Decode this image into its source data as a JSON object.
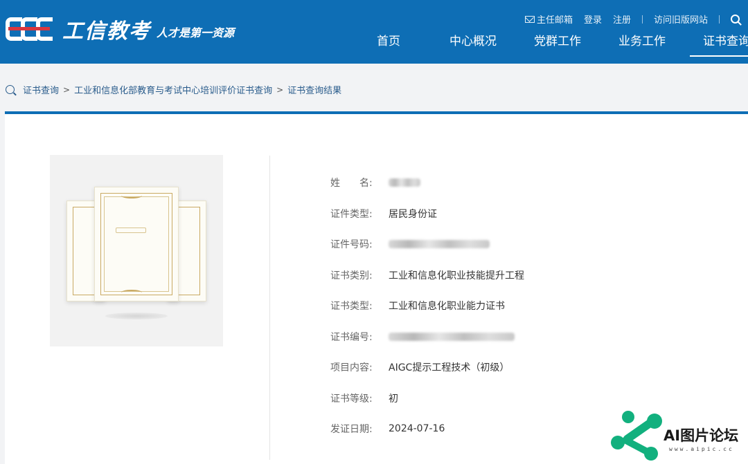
{
  "header": {
    "logo_text": "工信教考",
    "slogan": "人才是第一资源",
    "top_links": {
      "mail": "主任邮箱",
      "login": "登录",
      "register": "注册",
      "old_site": "访问旧版网站"
    },
    "nav": [
      "首页",
      "中心概况",
      "党群工作",
      "业务工作",
      "证书查询"
    ],
    "active_nav": "证书查询"
  },
  "breadcrumb": {
    "items": [
      "证书查询",
      "工业和信息化部教育与考试中心培训评价证书查询",
      "证书查询结果"
    ],
    "separator": ">"
  },
  "certificate": {
    "fields": [
      {
        "label": "姓　　名:",
        "value": "",
        "redacted": true
      },
      {
        "label": "证件类型:",
        "value": "居民身份证",
        "redacted": false
      },
      {
        "label": "证件号码:",
        "value": "",
        "redacted": true
      },
      {
        "label": "证书类别:",
        "value": "工业和信息化职业技能提升工程",
        "redacted": false
      },
      {
        "label": "证书类型:",
        "value": "工业和信息化职业能力证书",
        "redacted": false
      },
      {
        "label": "证书编号:",
        "value": "",
        "redacted": true
      },
      {
        "label": "项目内容:",
        "value": "AIGC提示工程技术（初级）",
        "redacted": false
      },
      {
        "label": "证书等级:",
        "value": "初",
        "redacted": false
      },
      {
        "label": "发证日期:",
        "value": "2024-07-16",
        "redacted": false
      }
    ]
  },
  "watermark": {
    "text": "AI图片论坛",
    "url": "www.aipic.cc"
  },
  "colors": {
    "brand": "#0e6eb5",
    "logo_accent": "#d9363e",
    "watermark": "#12b07e"
  }
}
